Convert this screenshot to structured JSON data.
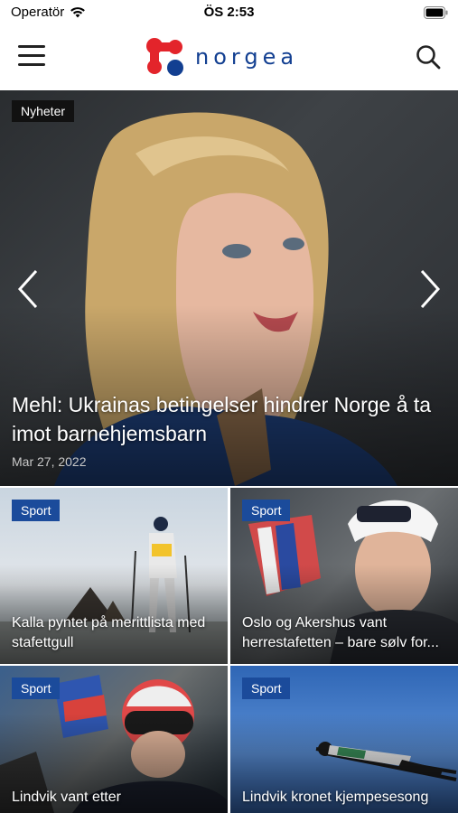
{
  "status_bar": {
    "carrier": "Operatör",
    "time": "ÖS 2:53"
  },
  "header": {
    "logo_text": "norgea",
    "brand_colors": {
      "red": "#e3242b",
      "blue": "#123f91"
    }
  },
  "hero": {
    "category": "Nyheter",
    "headline": "Mehl: Ukrainas betingelser hindrer Norge å ta imot barnehjemsbarn",
    "date": "Mar 27, 2022"
  },
  "cards": [
    {
      "category": "Sport",
      "title": "Kalla pyntet på merittlista med stafettgull"
    },
    {
      "category": "Sport",
      "title": "Oslo og Akershus vant herrestafetten – bare sølv for..."
    },
    {
      "category": "Sport",
      "title": "Lindvik vant etter"
    },
    {
      "category": "Sport",
      "title": "Lindvik kronet kjempesesong"
    }
  ],
  "colors": {
    "tag_blue": "#1b4b9b",
    "tag_dark": "#111111"
  }
}
